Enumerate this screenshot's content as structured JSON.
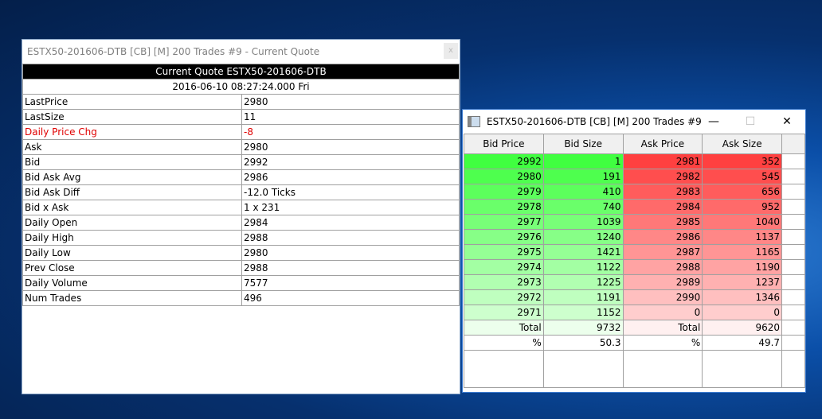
{
  "quote_window": {
    "title": "ESTX50-201606-DTB [CB] [M]  200 Trades  #9 - Current Quote",
    "close": "x",
    "header": "Current Quote  ESTX50-201606-DTB",
    "datetime": "2016-06-10  08:27:24.000 Fri",
    "rows": [
      {
        "label": "LastPrice",
        "value": "2980"
      },
      {
        "label": "LastSize",
        "value": "11"
      },
      {
        "label": "Daily Price Chg",
        "value": "-8",
        "highlight": "#e00000"
      },
      {
        "label": "Ask",
        "value": "2980"
      },
      {
        "label": "Bid",
        "value": "2992"
      },
      {
        "label": "Bid Ask Avg",
        "value": "2986"
      },
      {
        "label": "Bid Ask Diff",
        "value": "-12.0 Ticks"
      },
      {
        "label": "Bid x Ask",
        "value": "1 x 231"
      },
      {
        "label": "Daily Open",
        "value": "2984"
      },
      {
        "label": "Daily High",
        "value": "2988"
      },
      {
        "label": "Daily Low",
        "value": "2980"
      },
      {
        "label": "Prev Close",
        "value": "2988"
      },
      {
        "label": "Daily Volume",
        "value": "7577"
      },
      {
        "label": "Num Trades",
        "value": "496"
      }
    ]
  },
  "book_window": {
    "title": "ESTX50-201606-DTB [CB] [M]  200 Trades  #9",
    "minimize": "—",
    "maximize": "☐",
    "close": "✕",
    "columns": [
      "Bid Price",
      "Bid Size",
      "Ask Price",
      "Ask Size"
    ],
    "rows": [
      [
        "2992",
        "1",
        "2981",
        "352"
      ],
      [
        "2980",
        "191",
        "2982",
        "545"
      ],
      [
        "2979",
        "410",
        "2983",
        "656"
      ],
      [
        "2978",
        "740",
        "2984",
        "952"
      ],
      [
        "2977",
        "1039",
        "2985",
        "1040"
      ],
      [
        "2976",
        "1240",
        "2986",
        "1137"
      ],
      [
        "2975",
        "1421",
        "2987",
        "1165"
      ],
      [
        "2974",
        "1122",
        "2988",
        "1190"
      ],
      [
        "2973",
        "1225",
        "2989",
        "1237"
      ],
      [
        "2972",
        "1191",
        "2990",
        "1346"
      ],
      [
        "2971",
        "1152",
        "0",
        "0"
      ]
    ],
    "total": [
      "Total",
      "9732",
      "Total",
      "9620"
    ],
    "percent": [
      "%",
      "50.3",
      "%",
      "49.7"
    ],
    "bid_color": "#40ff40",
    "ask_color": "#ff4040"
  }
}
